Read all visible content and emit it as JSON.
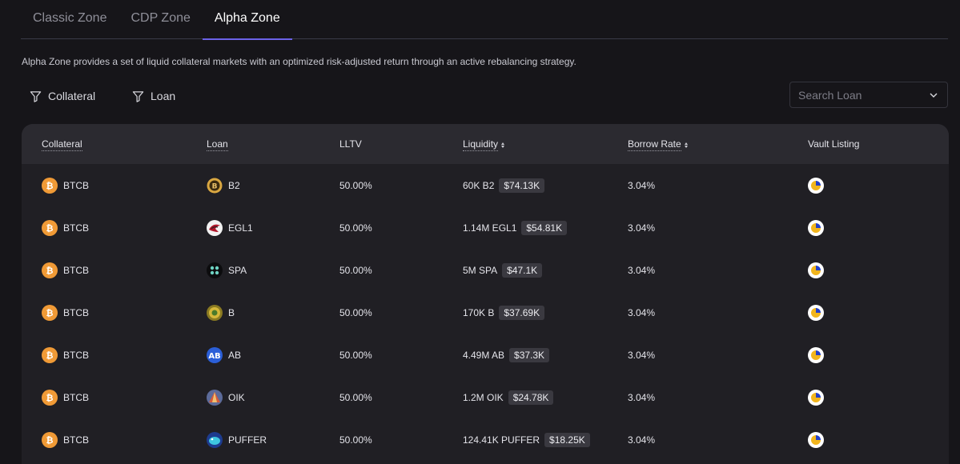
{
  "tabs": [
    {
      "label": "Classic Zone",
      "active": false
    },
    {
      "label": "CDP Zone",
      "active": false
    },
    {
      "label": "Alpha Zone",
      "active": true
    }
  ],
  "description": "Alpha Zone provides a set of liquid collateral markets with an optimized risk-adjusted return through an active rebalancing strategy.",
  "filters": {
    "collateral_label": "Collateral",
    "loan_label": "Loan",
    "search_placeholder": "Search Loan"
  },
  "table": {
    "headers": {
      "collateral": "Collateral",
      "loan": "Loan",
      "lltv": "LLTV",
      "liquidity": "Liquidity",
      "borrow_rate": "Borrow Rate",
      "vault_listing": "Vault Listing"
    },
    "rows": [
      {
        "collateral": "BTCB",
        "loan": "B2",
        "lltv": "50.00%",
        "liquidity": "60K B2",
        "liquidity_usd": "$74.13K",
        "borrow_rate": "3.04%",
        "loan_icon": "b2-token-icon"
      },
      {
        "collateral": "BTCB",
        "loan": "EGL1",
        "lltv": "50.00%",
        "liquidity": "1.14M EGL1",
        "liquidity_usd": "$54.81K",
        "borrow_rate": "3.04%",
        "loan_icon": "egl1-token-icon"
      },
      {
        "collateral": "BTCB",
        "loan": "SPA",
        "lltv": "50.00%",
        "liquidity": "5M SPA",
        "liquidity_usd": "$47.1K",
        "borrow_rate": "3.04%",
        "loan_icon": "spa-token-icon"
      },
      {
        "collateral": "BTCB",
        "loan": "B",
        "lltv": "50.00%",
        "liquidity": "170K B",
        "liquidity_usd": "$37.69K",
        "borrow_rate": "3.04%",
        "loan_icon": "b-token-icon"
      },
      {
        "collateral": "BTCB",
        "loan": "AB",
        "lltv": "50.00%",
        "liquidity": "4.49M AB",
        "liquidity_usd": "$37.3K",
        "borrow_rate": "3.04%",
        "loan_icon": "ab-token-icon"
      },
      {
        "collateral": "BTCB",
        "loan": "OIK",
        "lltv": "50.00%",
        "liquidity": "1.2M OIK",
        "liquidity_usd": "$24.78K",
        "borrow_rate": "3.04%",
        "loan_icon": "oik-token-icon"
      },
      {
        "collateral": "BTCB",
        "loan": "PUFFER",
        "lltv": "50.00%",
        "liquidity": "124.41K PUFFER",
        "liquidity_usd": "$18.25K",
        "borrow_rate": "3.04%",
        "loan_icon": "puffer-token-icon"
      }
    ]
  },
  "colors": {
    "background": "#161519",
    "accent": "#6b62e8",
    "btc_orange": "#f09a36"
  }
}
